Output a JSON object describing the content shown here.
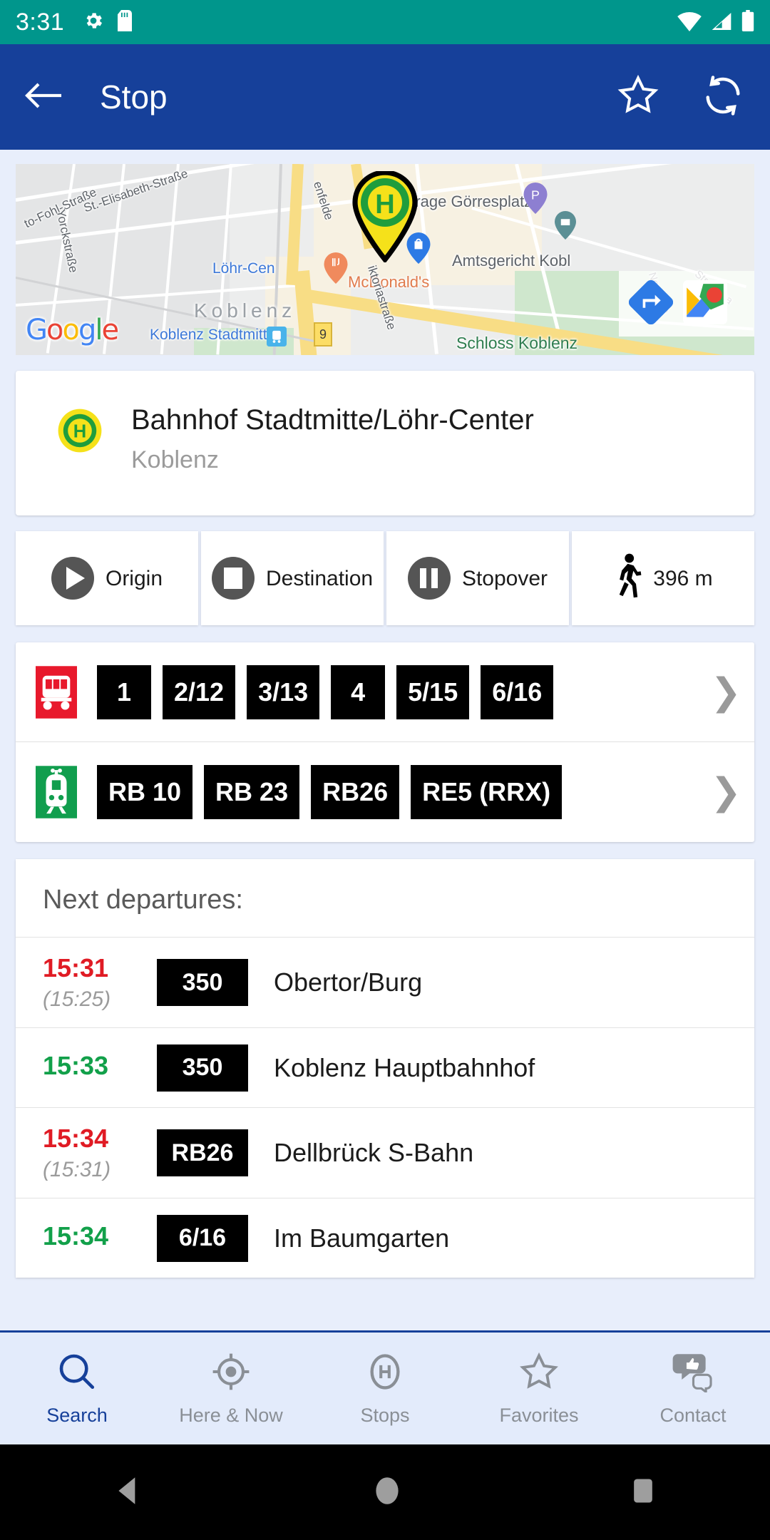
{
  "status_bar": {
    "time": "3:31",
    "icons": [
      "gear-icon",
      "sd-card-icon",
      "wifi-icon",
      "signal-icon",
      "battery-icon"
    ]
  },
  "app_bar": {
    "title": "Stop",
    "back_icon": "back-arrow-icon",
    "favorite_icon": "star-outline-icon",
    "refresh_icon": "refresh-icon",
    "background": "#16409a"
  },
  "map": {
    "attribution": "Google",
    "google_letters": [
      "G",
      "o",
      "o",
      "g",
      "l",
      "e"
    ],
    "city_label": "Koblenz",
    "highway_shield": "9",
    "labels": [
      {
        "text": "to-Fohl-Straße",
        "color": "grey"
      },
      {
        "text": "St.-Elisabeth-Straße",
        "color": "grey"
      },
      {
        "text": "Yorckstraße",
        "color": "grey"
      },
      {
        "text": "Löhr-Cen",
        "color": "blue"
      },
      {
        "text": "Koblenz Stadtmitte",
        "color": "blue"
      },
      {
        "text": "enfelde",
        "color": "grey"
      },
      {
        "text": "Tiefgarage Görresplatz",
        "color": "grey"
      },
      {
        "text": "Amtsgericht Kobl",
        "color": "grey"
      },
      {
        "text": "McDonald's",
        "color": "orange"
      },
      {
        "text": "iktoriastraße",
        "color": "grey"
      },
      {
        "text": "Neustadt",
        "color": "grey"
      },
      {
        "text": "Stresema",
        "color": "grey"
      },
      {
        "text": "Schloss Koblenz",
        "color": "green"
      }
    ],
    "marker_icon": "bus-stop-marker-icon",
    "controls": [
      "directions-icon",
      "open-google-maps-icon"
    ]
  },
  "stop": {
    "icon": "bus-stop-h-icon",
    "name": "Bahnhof Stadtmitte/Löhr-Center",
    "city": "Koblenz"
  },
  "actions": [
    {
      "label": "Origin",
      "icon": "play-circle-icon"
    },
    {
      "label": "Destination",
      "icon": "stop-circle-icon"
    },
    {
      "label": "Stopover",
      "icon": "pause-circle-icon"
    },
    {
      "label": "396 m",
      "icon": "walking-person-icon"
    }
  ],
  "line_groups": [
    {
      "mode": "bus",
      "icon": "bus-icon",
      "icon_color": "#e8192c",
      "lines": [
        "1",
        "2/12",
        "3/13",
        "4",
        "5/15",
        "6/16"
      ],
      "more_icon": "chevron-right-icon"
    },
    {
      "mode": "train",
      "icon": "train-icon",
      "icon_color": "#119e4e",
      "lines": [
        "RB 10",
        "RB 23",
        "RB26",
        "RE5 (RRX)"
      ],
      "more_icon": "chevron-right-icon"
    }
  ],
  "departures": {
    "title": "Next departures:",
    "rows": [
      {
        "time": "15:31",
        "scheduled": "(15:25)",
        "status": "late",
        "line": "350",
        "destination": "Obertor/Burg"
      },
      {
        "time": "15:33",
        "scheduled": "",
        "status": "ontime",
        "line": "350",
        "destination": "Koblenz Hauptbahnhof"
      },
      {
        "time": "15:34",
        "scheduled": "(15:31)",
        "status": "late",
        "line": "RB26",
        "destination": "Dellbrück S-Bahn"
      },
      {
        "time": "15:34",
        "scheduled": "",
        "status": "ontime",
        "line": "6/16",
        "destination": "Im Baumgarten"
      }
    ],
    "colors": {
      "late": "#e01b24",
      "ontime": "#12a04a"
    }
  },
  "bottom_nav": {
    "active_color": "#16409a",
    "items": [
      {
        "label": "Search",
        "icon": "search-icon",
        "active": true
      },
      {
        "label": "Here & Now",
        "icon": "crosshair-icon",
        "active": false
      },
      {
        "label": "Stops",
        "icon": "stop-h-icon",
        "active": false
      },
      {
        "label": "Favorites",
        "icon": "star-icon",
        "active": false
      },
      {
        "label": "Contact",
        "icon": "feedback-icon",
        "active": false
      }
    ]
  },
  "android_nav": {
    "back_icon": "android-back-icon",
    "home_icon": "android-home-icon",
    "recents_icon": "android-recents-icon"
  }
}
